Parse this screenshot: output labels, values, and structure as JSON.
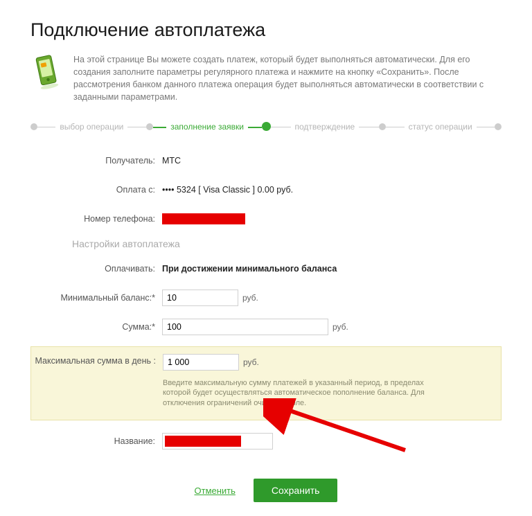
{
  "page": {
    "title": "Подключение автоплатежа",
    "intro": "На этой странице Вы можете создать платеж, который будет выполняться автоматически. Для его создания заполните параметры регулярного платежа и нажмите на кнопку «Сохранить». После рассмотрения банком данного платежа операция будет выполняться автоматически в соответствии с заданными параметрами."
  },
  "stepper": {
    "s1": "выбор операции",
    "s2": "заполнение заявки",
    "s3": "подтверждение",
    "s4": "статус операции"
  },
  "form": {
    "recipient_label": "Получатель:",
    "recipient_value": "МТС",
    "payfrom_label": "Оплата с:",
    "payfrom_value": "•••• 5324  [ Visa Classic ]  0.00  руб.",
    "phone_label": "Номер телефона:",
    "section_title": "Настройки автоплатежа",
    "paywhen_label": "Оплачивать:",
    "paywhen_value": "При достижении минимального баланса",
    "minbal_label": "Минимальный баланс:*",
    "minbal_value": "10",
    "sum_label": "Сумма:*",
    "sum_value": "100",
    "maxday_label": "Максимальная сумма в день :",
    "maxday_value": "1 000",
    "maxday_hint": "Введите максимальную сумму платежей в указанный период, в пределах которой будет осуществляться автоматическое пополнение баланса. Для отключения ограничений очистите поле.",
    "name_label": "Название:",
    "unit": "руб."
  },
  "buttons": {
    "cancel": "Отменить",
    "save": "Сохранить"
  }
}
